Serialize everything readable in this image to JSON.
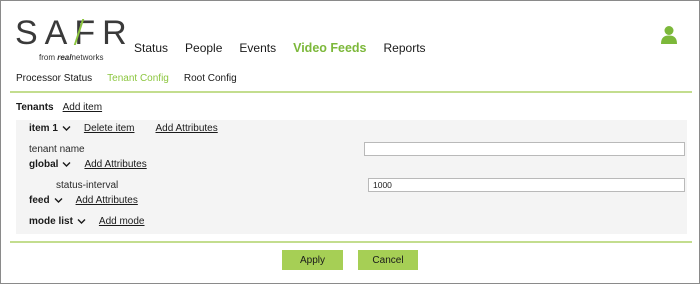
{
  "brand": {
    "logo_text": "SAFR",
    "logo_sub_prefix": "from",
    "logo_sub_brand": "real",
    "logo_sub_suffix": "networks",
    "accent_color": "#8cc63f"
  },
  "main_nav": {
    "items": [
      {
        "label": "Status"
      },
      {
        "label": "People"
      },
      {
        "label": "Events"
      },
      {
        "label": "Video Feeds"
      },
      {
        "label": "Reports"
      }
    ],
    "active": "Video Feeds"
  },
  "user": {
    "icon": "user-icon"
  },
  "sub_nav": {
    "items": [
      {
        "label": "Processor Status"
      },
      {
        "label": "Tenant Config"
      },
      {
        "label": "Root Config"
      }
    ],
    "active": "Tenant Config"
  },
  "tenants": {
    "title": "Tenants",
    "add_item_label": "Add item",
    "item": {
      "label": "item 1",
      "delete_label": "Delete item",
      "add_attributes_label": "Add Attributes",
      "tenant_name_label": "tenant name",
      "tenant_name_value": "",
      "global": {
        "label": "global",
        "add_attributes_label": "Add Attributes",
        "status_interval_label": "status-interval",
        "status_interval_value": "1000"
      },
      "feed": {
        "label": "feed",
        "add_attributes_label": "Add Attributes"
      },
      "mode_list": {
        "label": "mode list",
        "add_mode_label": "Add mode"
      }
    }
  },
  "actions": {
    "apply_label": "Apply",
    "cancel_label": "Cancel",
    "button_color": "#a6cf55"
  }
}
